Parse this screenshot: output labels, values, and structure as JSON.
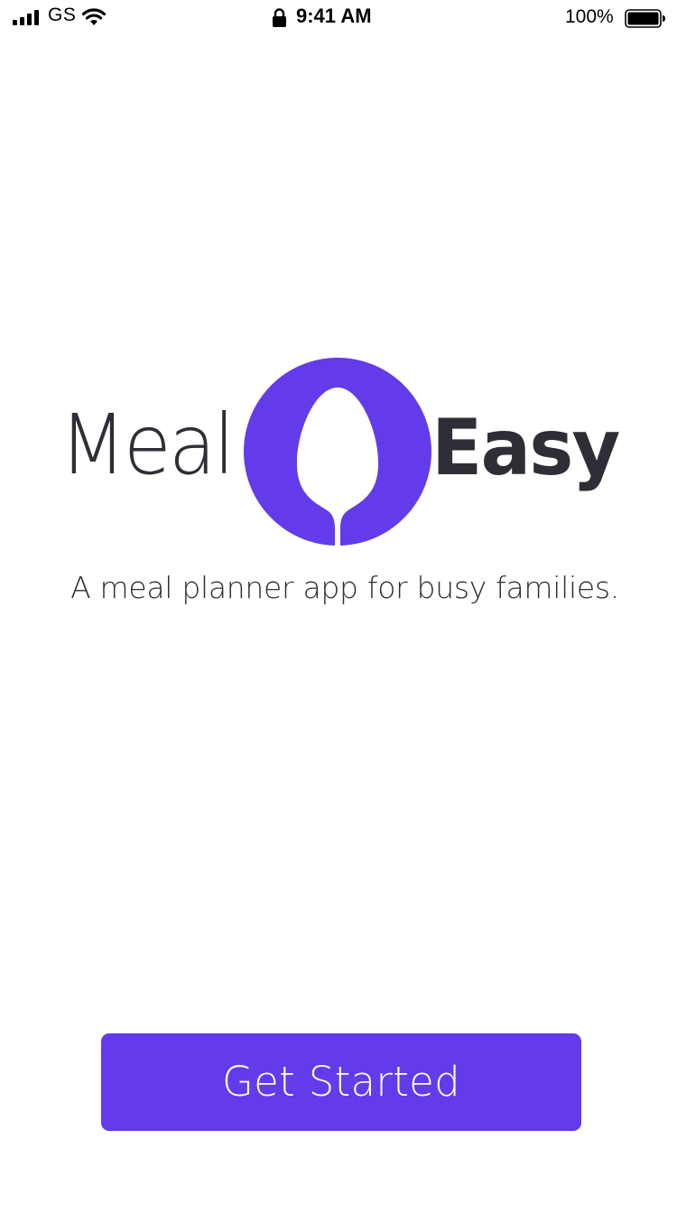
{
  "status_bar": {
    "carrier": "GS",
    "time": "9:41 AM",
    "battery_percent": "100%",
    "icons": [
      "signal-bars-icon",
      "wifi-icon",
      "lock-icon",
      "battery-icon"
    ]
  },
  "logo": {
    "word_left": "Meal",
    "word_right": "Easy",
    "mark_icon": "spoon-icon"
  },
  "tagline": "A meal planner app for busy families.",
  "cta": {
    "label": "Get Started"
  },
  "colors": {
    "brand": "#633bea",
    "text": "#2f2e36",
    "background": "#ffffff"
  }
}
